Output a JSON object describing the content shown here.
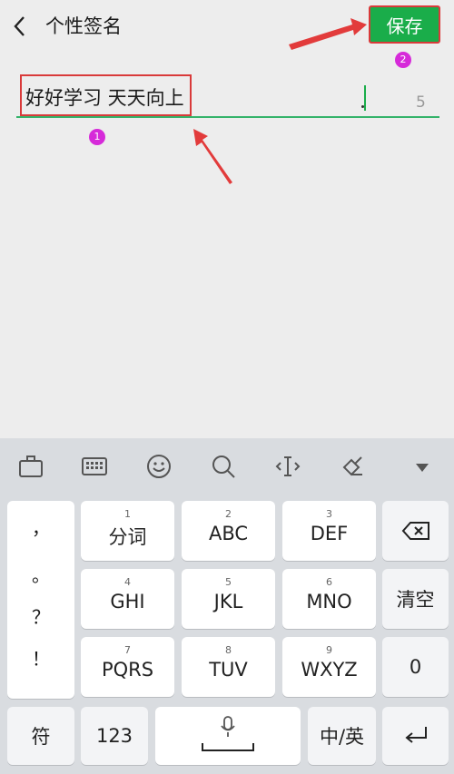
{
  "header": {
    "title": "个性签名",
    "save_label": "保存",
    "marker_save": "2"
  },
  "input": {
    "value": "好好学习 天天向上",
    "char_count": "5",
    "marker_input": "1"
  },
  "keyboard": {
    "toolbar": [
      "briefcase-icon",
      "keyboard-icon",
      "emoji-icon",
      "search-icon",
      "cursor-move-icon",
      "clean-icon",
      "collapse-icon"
    ],
    "punctuation": [
      "，",
      "。",
      "？",
      "！"
    ],
    "keys": {
      "k1_num": "1",
      "k1_label": "分词",
      "k2_num": "2",
      "k2_label": "ABC",
      "k3_num": "3",
      "k3_label": "DEF",
      "k4_num": "4",
      "k4_label": "GHI",
      "k5_num": "5",
      "k5_label": "JKL",
      "k6_num": "6",
      "k6_label": "MNO",
      "k7_num": "7",
      "k7_label": "PQRS",
      "k8_num": "8",
      "k8_label": "TUV",
      "k9_num": "9",
      "k9_label": "WXYZ",
      "clear": "清空",
      "zero": "0",
      "symbol": "符",
      "numbers": "123",
      "lang": "中/英"
    }
  },
  "colors": {
    "accent": "#1aad4a",
    "annotation_red": "#d93a3a",
    "marker_purple": "#d62ad9"
  }
}
